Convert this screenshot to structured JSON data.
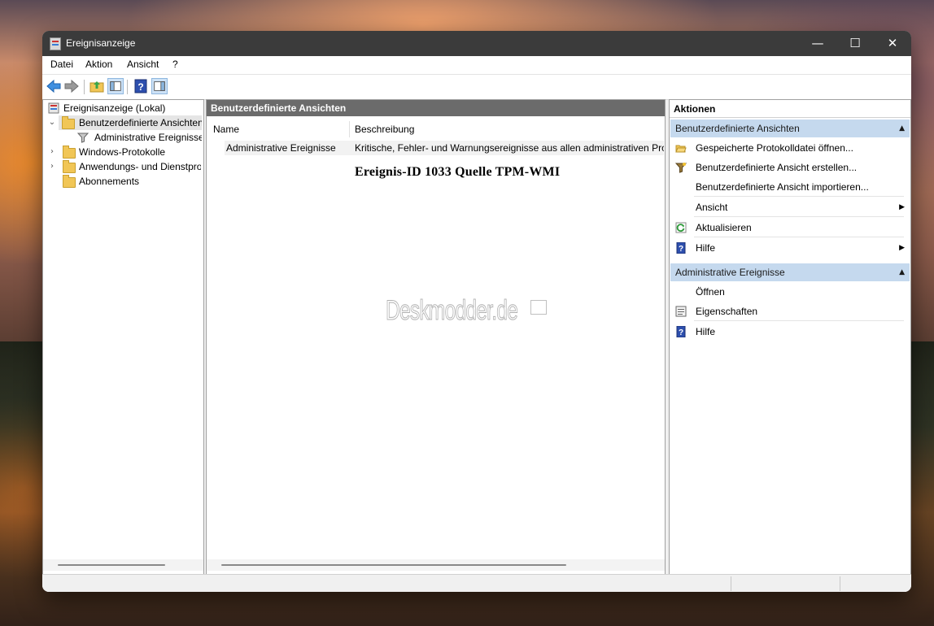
{
  "window": {
    "title": "Ereignisanzeige"
  },
  "menu": {
    "items": [
      "Datei",
      "Aktion",
      "Ansicht",
      "?"
    ]
  },
  "tree": {
    "root": "Ereignisanzeige (Lokal)",
    "items": [
      {
        "label": "Benutzerdefinierte Ansichten"
      },
      {
        "label": "Administrative Ereignisse"
      },
      {
        "label": "Windows-Protokolle"
      },
      {
        "label": "Anwendungs- und Dienstprotokolle"
      },
      {
        "label": "Abonnements"
      }
    ]
  },
  "middle": {
    "header": "Benutzerdefinierte Ansichten",
    "columns": [
      "Name",
      "Beschreibung"
    ],
    "rows": [
      {
        "name": "Administrative Ereignisse",
        "description": "Kritische, Fehler- und Warnungsereignisse aus allen administrativen Protokollen."
      }
    ],
    "overlay": "Ereignis-ID 1033  Quelle TPM-WMI",
    "watermark": "Deskmodder.de"
  },
  "actions": {
    "title": "Aktionen",
    "section1": {
      "title": "Benutzerdefinierte Ansichten",
      "items": [
        "Gespeicherte Protokolldatei öffnen...",
        "Benutzerdefinierte Ansicht erstellen...",
        "Benutzerdefinierte Ansicht importieren...",
        "Ansicht",
        "Aktualisieren",
        "Hilfe"
      ]
    },
    "section2": {
      "title": "Administrative Ereignisse",
      "items": [
        "Öffnen",
        "Eigenschaften",
        "Hilfe"
      ]
    }
  },
  "colors": {
    "section_bg": "#c5d9ee",
    "header_bg": "#6b6b6b",
    "titlebar_bg": "#3b3b3b"
  }
}
